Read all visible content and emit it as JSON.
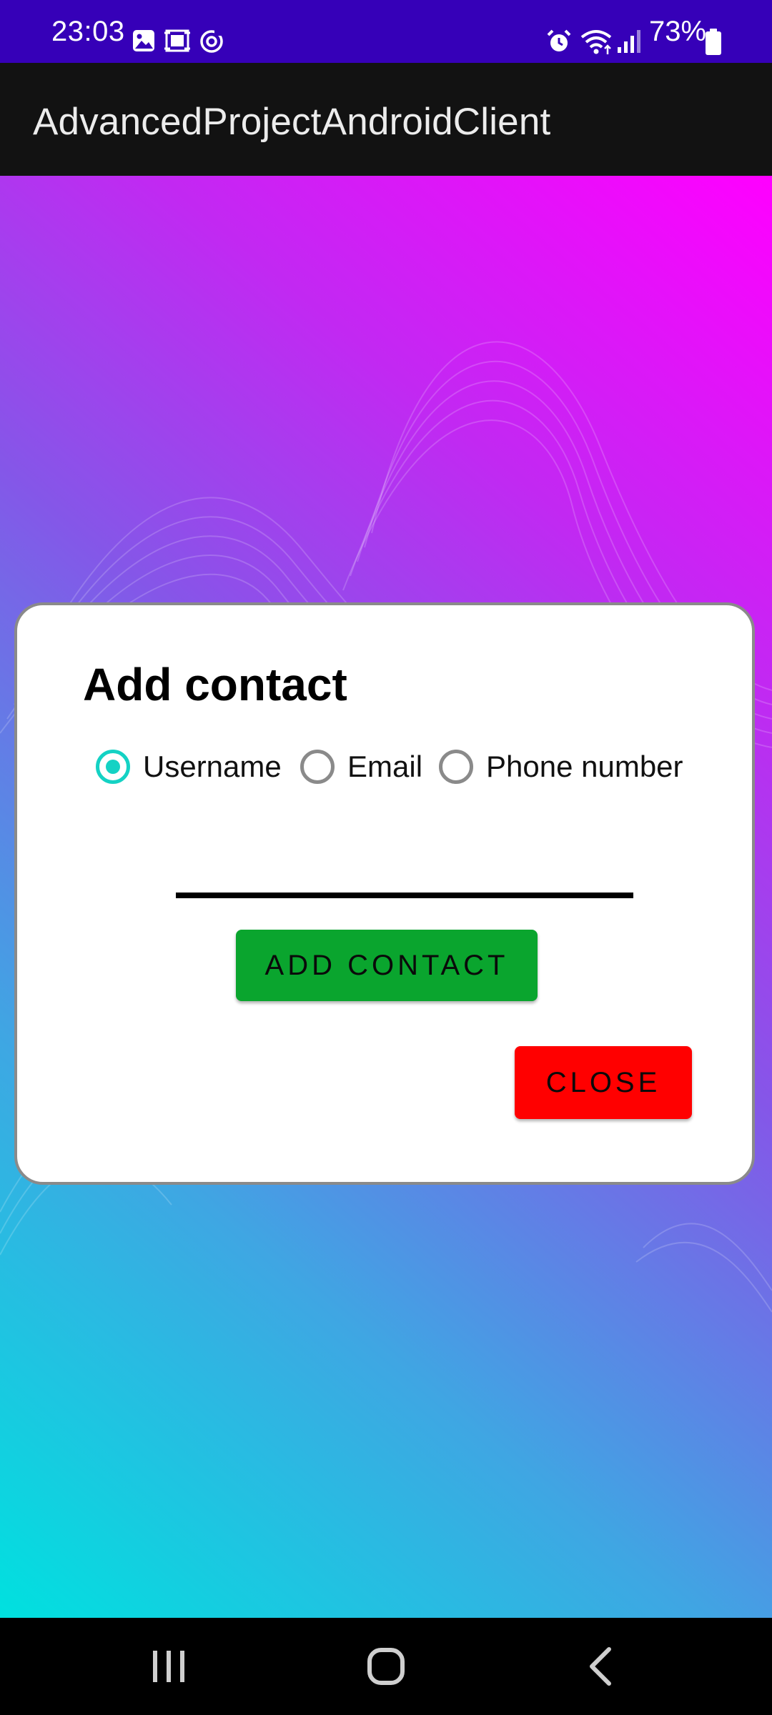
{
  "status_bar": {
    "time": "23:03",
    "battery_percent": "73%",
    "icons": [
      "gallery-icon",
      "screenshot-icon",
      "sync-icon",
      "alarm-icon",
      "wifi-icon",
      "signal-icon",
      "battery-icon"
    ],
    "background_color": "#3600b8"
  },
  "app_bar": {
    "title": "AdvancedProjectAndroidClient",
    "background_color": "#121212"
  },
  "dialog": {
    "title": "Add contact",
    "radio_options": [
      {
        "label": "Username",
        "checked": true
      },
      {
        "label": "Email",
        "checked": false
      },
      {
        "label": "Phone number",
        "checked": false
      }
    ],
    "input": {
      "value": "",
      "placeholder": ""
    },
    "add_button_label": "ADD CONTACT",
    "close_button_label": "CLOSE",
    "accent_color": "#14d2c4",
    "add_button_color": "#0aa52e",
    "close_button_color": "#ff0000"
  },
  "navigation_bar": {
    "buttons": [
      "recent-apps-icon",
      "home-icon",
      "back-icon"
    ]
  }
}
